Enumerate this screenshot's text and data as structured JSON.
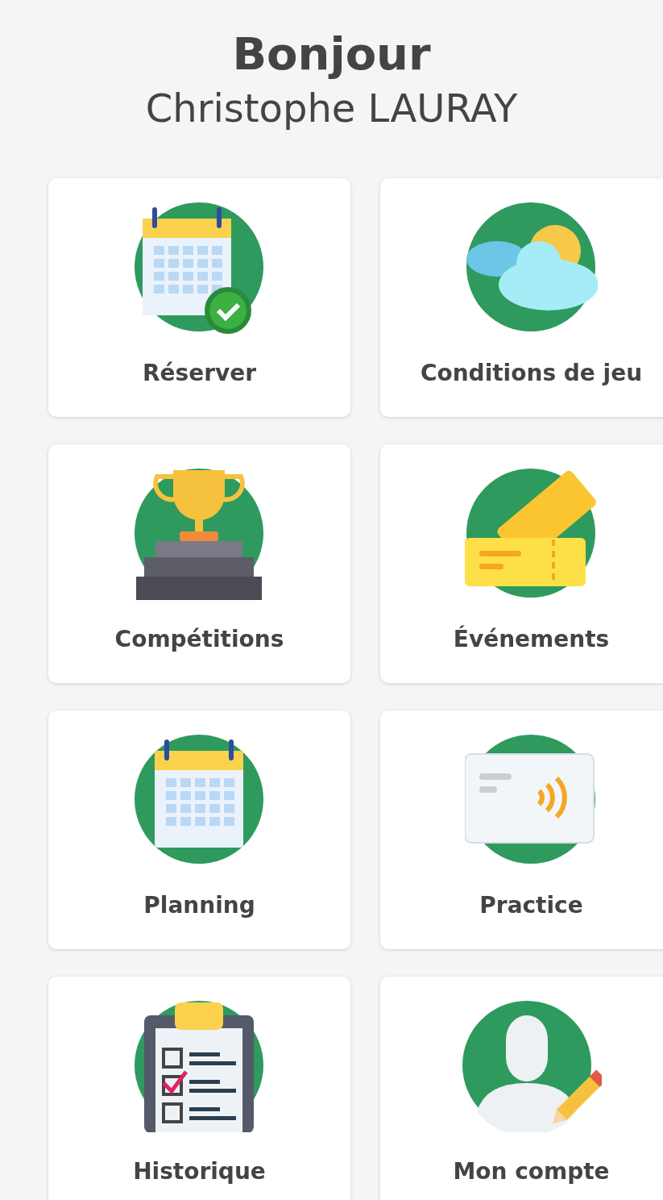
{
  "greeting": {
    "title": "Bonjour",
    "name": "Christophe LAURAY"
  },
  "tiles": [
    {
      "label": "Réserver",
      "kind": "calendar-check"
    },
    {
      "label": "Conditions de jeu",
      "kind": "weather"
    },
    {
      "label": "Compétitions",
      "kind": "trophy"
    },
    {
      "label": "Événements",
      "kind": "tickets"
    },
    {
      "label": "Planning",
      "kind": "calendar"
    },
    {
      "label": "Practice",
      "kind": "card"
    },
    {
      "label": "Historique",
      "kind": "checklist"
    },
    {
      "label": "Mon compte",
      "kind": "account"
    }
  ]
}
